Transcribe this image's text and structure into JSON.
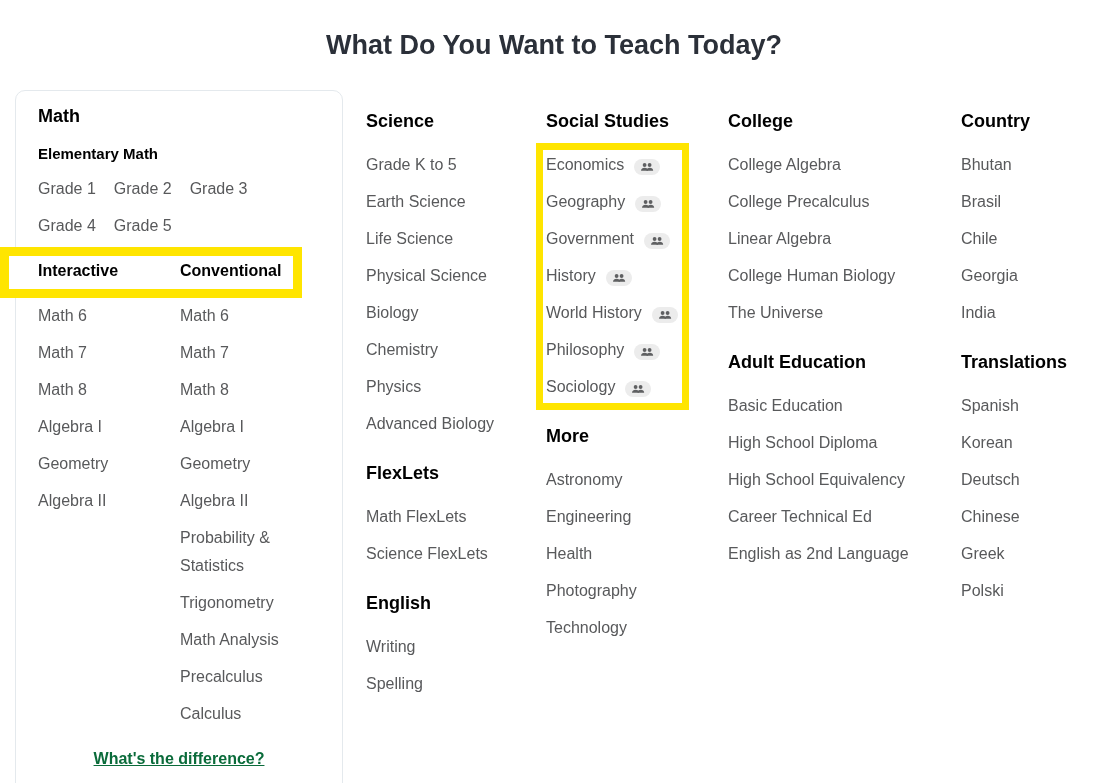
{
  "title": "What Do You Want to Teach Today?",
  "math_card": {
    "heading": "Math",
    "subheading": "Elementary Math",
    "grades": [
      "Grade 1",
      "Grade 2",
      "Grade 3",
      "Grade 4",
      "Grade 5"
    ],
    "tracks_highlighted": true,
    "tracks": [
      {
        "heading": "Interactive",
        "items": [
          "Math 6",
          "Math 7",
          "Math 8",
          "Algebra I",
          "Geometry",
          "Algebra II"
        ]
      },
      {
        "heading": "Conventional",
        "items": [
          "Math 6",
          "Math 7",
          "Math 8",
          "Algebra I",
          "Geometry",
          "Algebra II",
          "Probability & Statistics",
          "Trigonometry",
          "Math Analysis",
          "Precalculus",
          "Calculus"
        ]
      }
    ],
    "link": "What's the difference?"
  },
  "columns": [
    {
      "sections": [
        {
          "heading": "Science",
          "highlighted": false,
          "group_badges": false,
          "items": [
            "Grade K to 5",
            "Earth Science",
            "Life Science",
            "Physical Science",
            "Biology",
            "Chemistry",
            "Physics",
            "Advanced Biology"
          ]
        },
        {
          "heading": "FlexLets",
          "highlighted": false,
          "group_badges": false,
          "items": [
            "Math FlexLets",
            "Science FlexLets"
          ]
        },
        {
          "heading": "English",
          "highlighted": false,
          "group_badges": false,
          "items": [
            "Writing",
            "Spelling"
          ]
        }
      ]
    },
    {
      "sections": [
        {
          "heading": "Social Studies",
          "highlighted": true,
          "group_badges": true,
          "items": [
            "Economics",
            "Geography",
            "Government",
            "History",
            "World History",
            "Philosophy",
            "Sociology"
          ]
        },
        {
          "heading": "More",
          "highlighted": false,
          "group_badges": false,
          "items": [
            "Astronomy",
            "Engineering",
            "Health",
            "Photography",
            "Technology"
          ]
        }
      ]
    },
    {
      "sections": [
        {
          "heading": "College",
          "highlighted": false,
          "group_badges": false,
          "items": [
            "College Algebra",
            "College Precalculus",
            "Linear Algebra",
            "College Human Biology",
            "The Universe"
          ]
        },
        {
          "heading": "Adult Education",
          "highlighted": false,
          "group_badges": false,
          "items": [
            "Basic Education",
            "High School Diploma",
            "High School Equivalency",
            "Career Technical Ed",
            "English as 2nd Language"
          ]
        }
      ]
    },
    {
      "sections": [
        {
          "heading": "Country",
          "highlighted": false,
          "group_badges": false,
          "items": [
            "Bhutan",
            "Brasil",
            "Chile",
            "Georgia",
            "India"
          ]
        },
        {
          "heading": "Translations",
          "highlighted": false,
          "group_badges": false,
          "items": [
            "Spanish",
            "Korean",
            "Deutsch",
            "Chinese",
            "Greek",
            "Polski"
          ]
        }
      ]
    }
  ]
}
